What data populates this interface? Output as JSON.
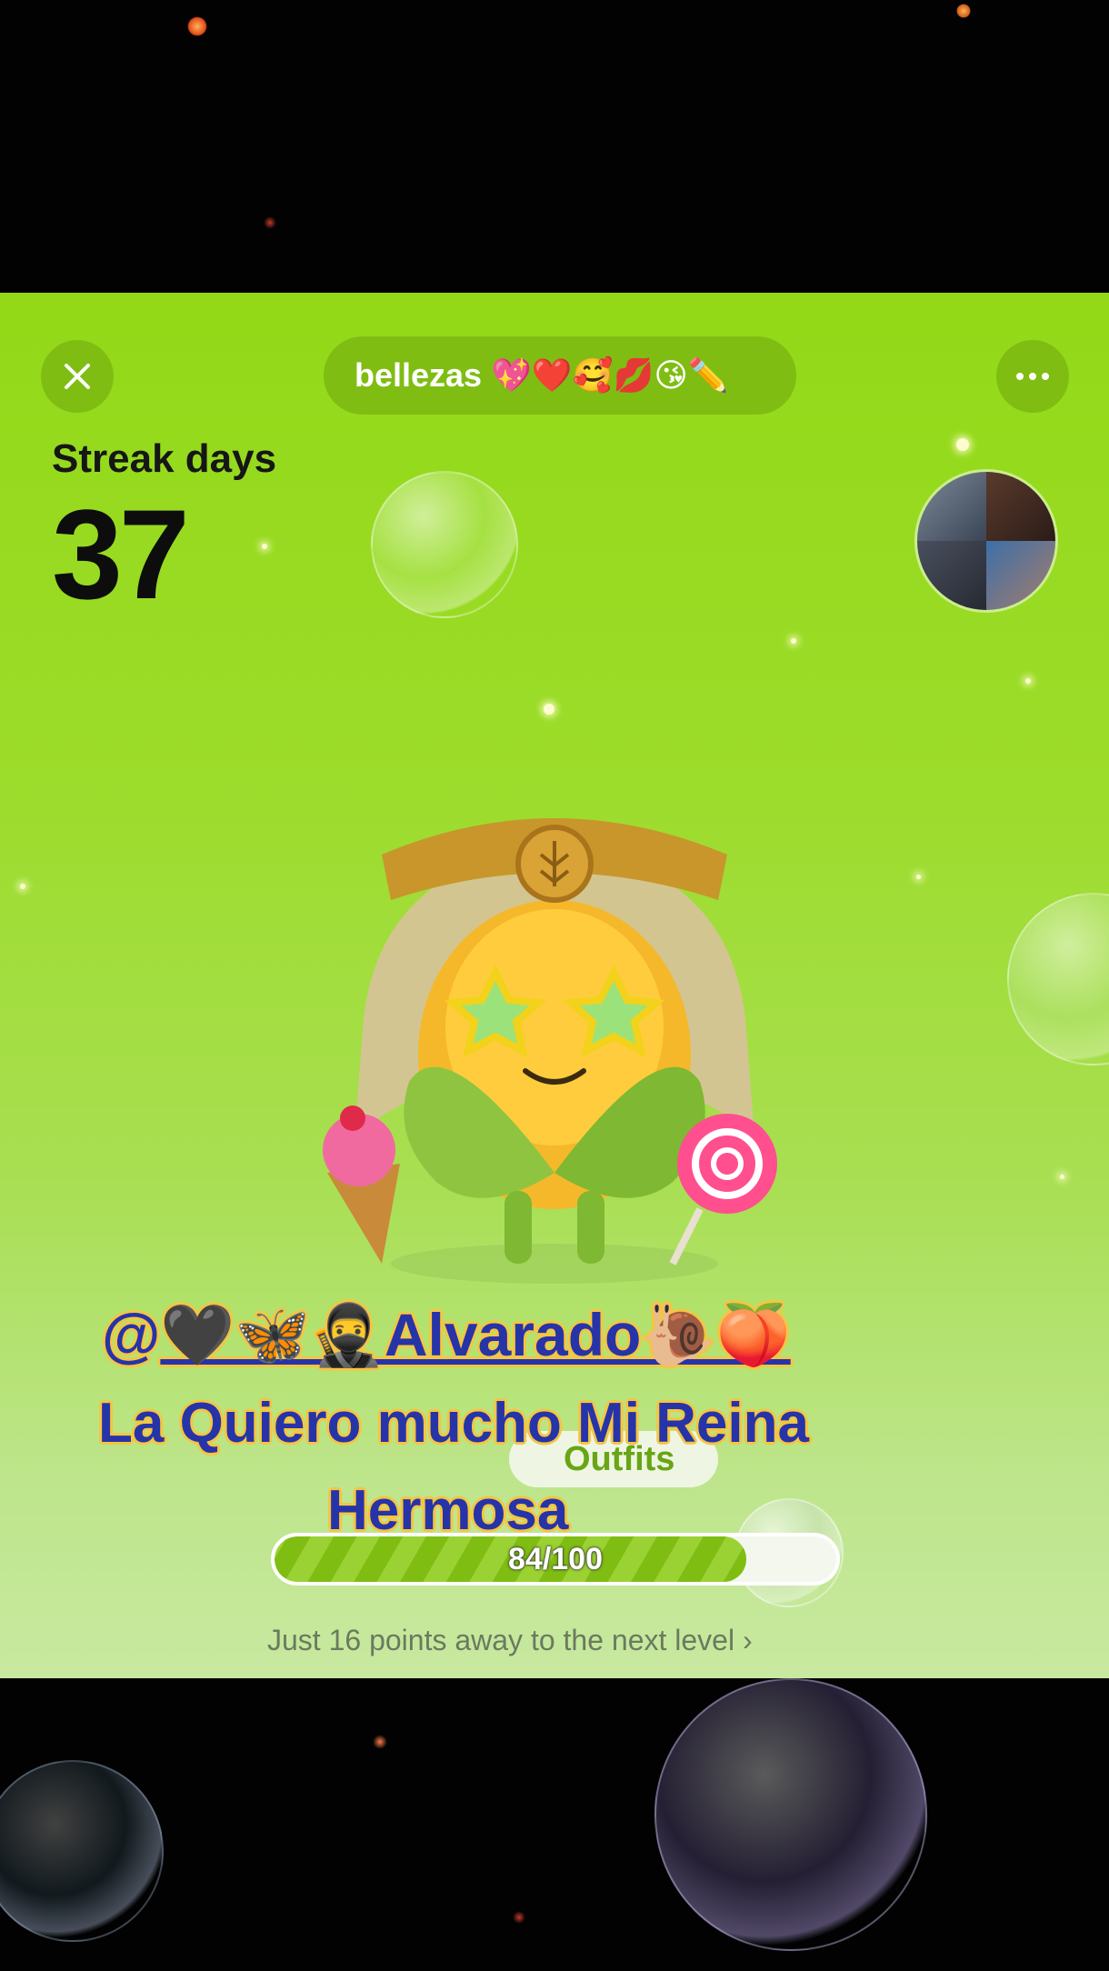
{
  "header": {
    "title": "bellezas 💖❤️🥰💋😘✏️",
    "close_icon": "close-icon",
    "more_icon": "more-horizontal-icon"
  },
  "streak": {
    "label": "Streak days",
    "value": "37"
  },
  "avatar": {
    "icon": "group-avatar"
  },
  "overlay": {
    "mention_prefix": "@",
    "mention_name": "🖤🦋🥷Alvarado🐌🍑",
    "dedication_line1": "La Quiero mucho Mi Reina",
    "dedication_line2": "Hermosa"
  },
  "outfits": {
    "label": "Outfits"
  },
  "progress": {
    "label": "84/100",
    "current": 84,
    "max": 100
  },
  "next_level": {
    "text": "Just 16 points away to the next level",
    "chevron": "›"
  },
  "colors": {
    "green_bg": "#93d917",
    "pill_green": "#7fbd13",
    "overlay_text": "#2634a8",
    "overlay_outline": "#f5c542"
  }
}
